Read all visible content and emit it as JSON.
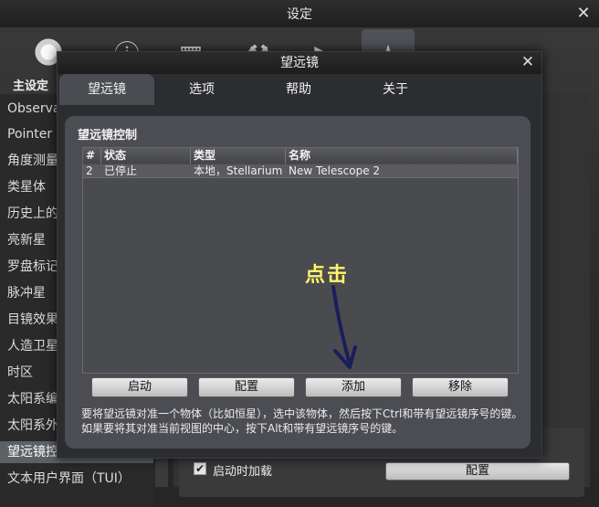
{
  "settings": {
    "title": "设定",
    "category_label": "主设定",
    "sidebar_items": [
      "Observability Analysis",
      "Pointer Coordinates",
      "角度测量",
      "类星体",
      "历史上的超新星",
      "亮新星",
      "罗盘标记",
      "脉冲星",
      "目镜效果",
      "人造卫星",
      "时区",
      "太阳系编辑器",
      "太阳系外行星",
      "望远镜控制",
      "文本用户界面（TUI）"
    ],
    "autoload_label": "启动时加载",
    "config_button": "配置"
  },
  "dialog": {
    "title": "望远镜",
    "tabs": [
      "望远镜",
      "选项",
      "帮助",
      "关于"
    ],
    "group_title": "望远镜控制",
    "table": {
      "columns": [
        "#",
        "状态",
        "类型",
        "名称"
      ],
      "rows": [
        [
          "2",
          "已停止",
          "本地，Stellarium",
          "New Telescope 2"
        ]
      ]
    },
    "buttons": [
      "启动",
      "配置",
      "添加",
      "移除"
    ],
    "help_text": "要将望远镜对准一个物体（比如恒星），选中该物体，然后按下Ctrl和带有望远镜序号的键。如果要将其对准当前视图的中心，按下Alt和带有望远镜序号的键。"
  },
  "annotation": {
    "text": "点击",
    "color": "#fff46a"
  }
}
